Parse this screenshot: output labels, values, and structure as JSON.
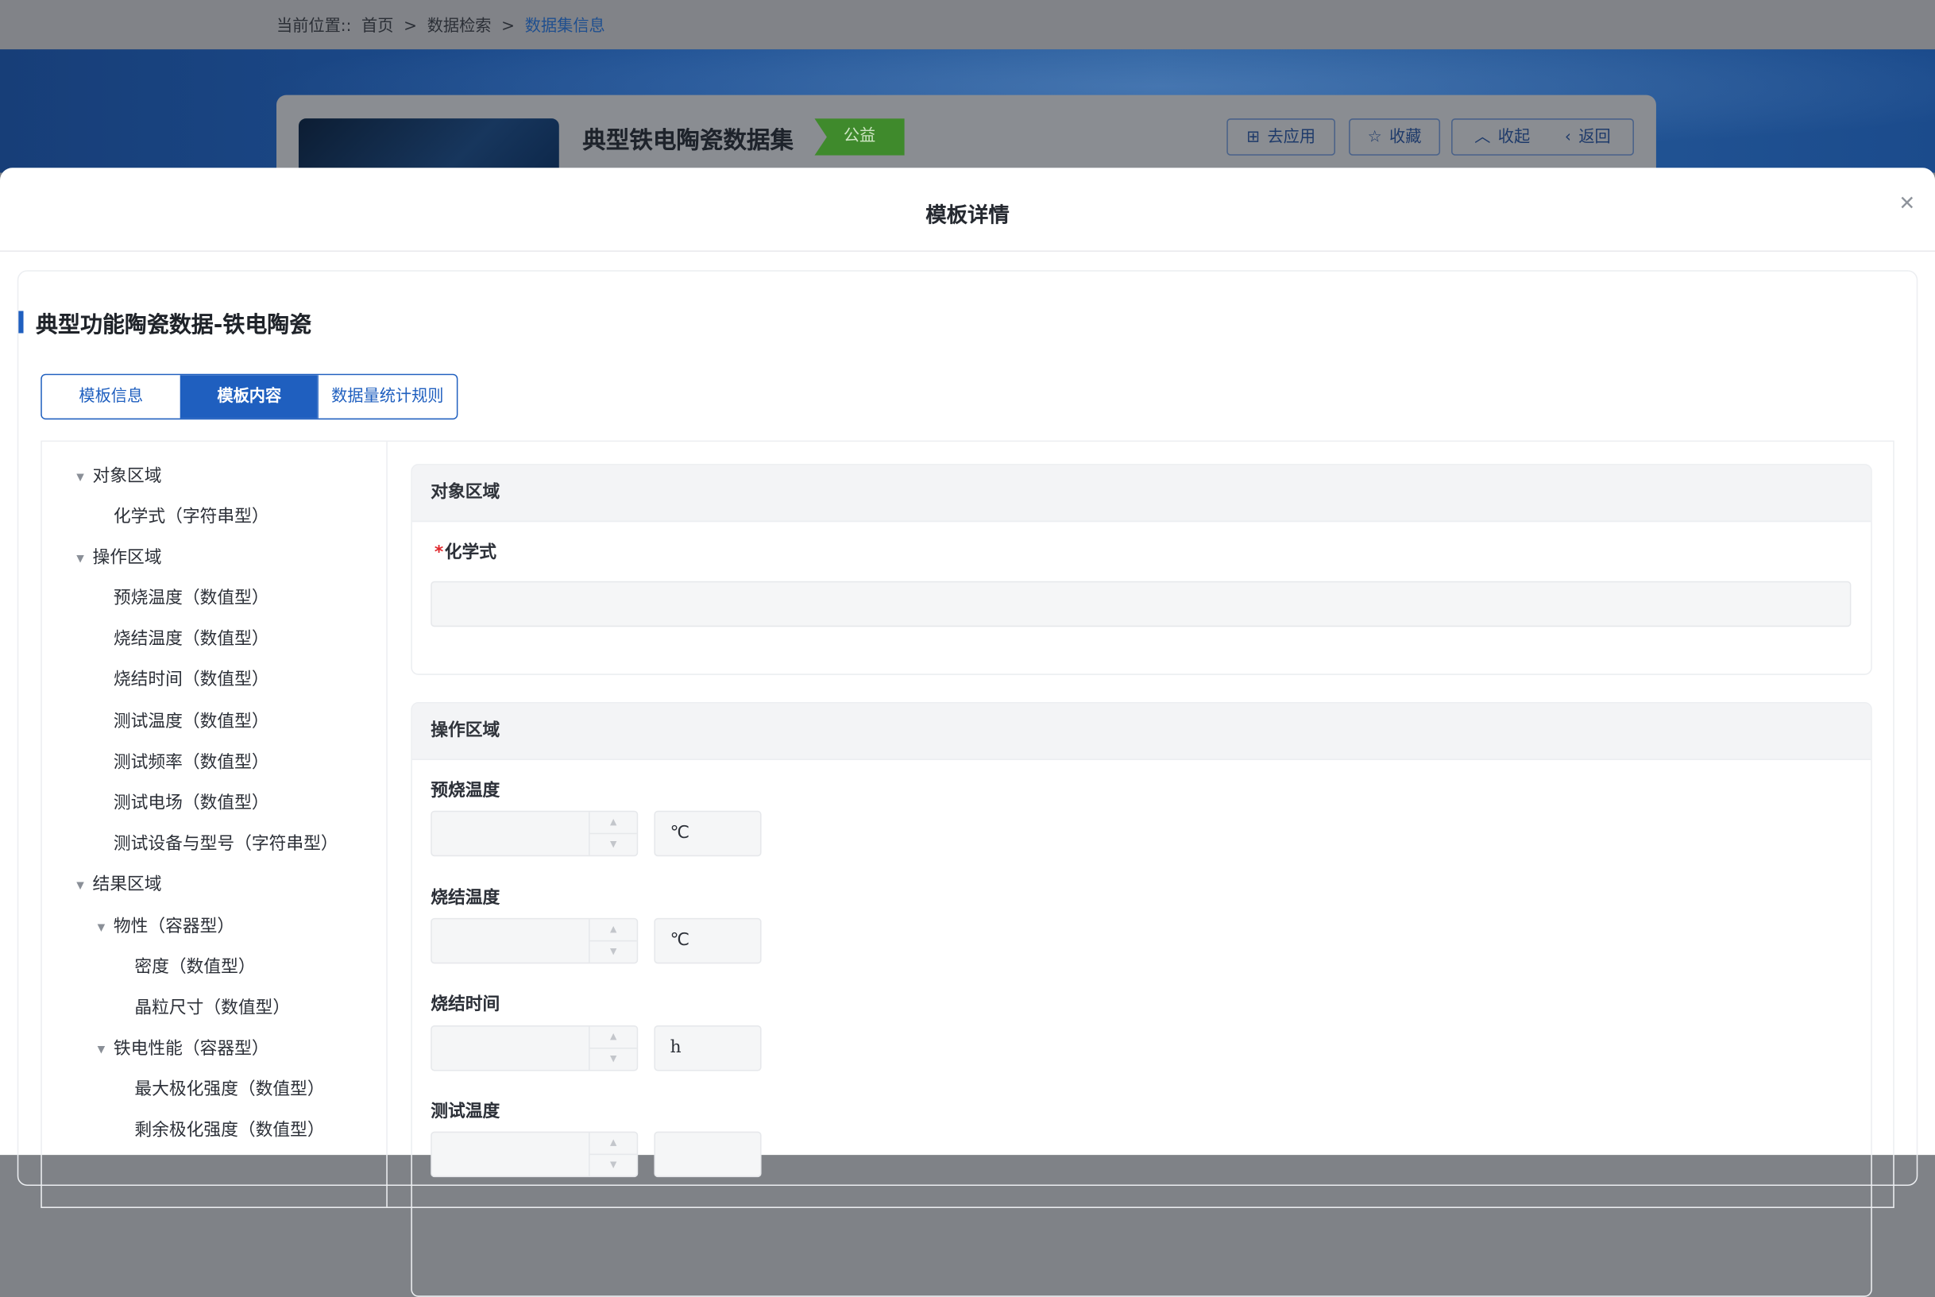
{
  "breadcrumb": {
    "prefix": "当前位置::",
    "home": "首页",
    "sep1": ">",
    "search": "数据检索",
    "sep2": ">",
    "current": "数据集信息"
  },
  "dataset": {
    "title": "典型铁电陶瓷数据集",
    "badge": "公益",
    "buttons": {
      "apply": "去应用",
      "favorite": "收藏",
      "collapse": "收起",
      "back": "返回"
    }
  },
  "modal": {
    "title": "模板详情",
    "close_icon": "close-icon",
    "section_title": "典型功能陶瓷数据-铁电陶瓷",
    "tabs": [
      "模板信息",
      "模板内容",
      "数据量统计规则"
    ],
    "active_tab": 1
  },
  "tree": [
    {
      "label": "对象区域",
      "level": 0,
      "expandable": true
    },
    {
      "label": "化学式（字符串型）",
      "level": 1,
      "expandable": false
    },
    {
      "label": "操作区域",
      "level": 0,
      "expandable": true
    },
    {
      "label": "预烧温度（数值型）",
      "level": 1,
      "expandable": false
    },
    {
      "label": "烧结温度（数值型）",
      "level": 1,
      "expandable": false
    },
    {
      "label": "烧结时间（数值型）",
      "level": 1,
      "expandable": false
    },
    {
      "label": "测试温度（数值型）",
      "level": 1,
      "expandable": false
    },
    {
      "label": "测试频率（数值型）",
      "level": 1,
      "expandable": false
    },
    {
      "label": "测试电场（数值型）",
      "level": 1,
      "expandable": false
    },
    {
      "label": "测试设备与型号（字符串型）",
      "level": 1,
      "expandable": false
    },
    {
      "label": "结果区域",
      "level": 0,
      "expandable": true
    },
    {
      "label": "物性（容器型）",
      "level": 1,
      "expandable": true
    },
    {
      "label": "密度（数值型）",
      "level": 2,
      "expandable": false
    },
    {
      "label": "晶粒尺寸（数值型）",
      "level": 2,
      "expandable": false
    },
    {
      "label": "铁电性能（容器型）",
      "level": 1,
      "expandable": true
    },
    {
      "label": "最大极化强度（数值型）",
      "level": 2,
      "expandable": false
    },
    {
      "label": "剩余极化强度（数值型）",
      "level": 2,
      "expandable": false
    }
  ],
  "form": {
    "object_group": {
      "title": "对象区域",
      "field_label": "化学式",
      "required_mark": "*",
      "value": ""
    },
    "operation_group": {
      "title": "操作区域",
      "fields": [
        {
          "label": "预烧温度",
          "value": "",
          "unit": "℃"
        },
        {
          "label": "烧结温度",
          "value": "",
          "unit": "℃"
        },
        {
          "label": "烧结时间",
          "value": "",
          "unit": "h"
        },
        {
          "label": "测试温度",
          "value": "",
          "unit": ""
        }
      ]
    }
  }
}
